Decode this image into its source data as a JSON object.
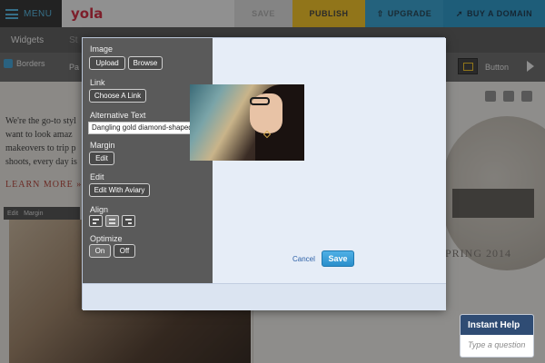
{
  "app": {
    "menu_label": "MENU",
    "logo": "yola",
    "save_label": "SAVE",
    "publish_label": "PUBLISH",
    "upgrade_label": "UPGRADE",
    "buy_domain_label": "BUY A DOMAIN"
  },
  "subbar": {
    "widgets_label": "Widgets",
    "faded_tab_label": "St"
  },
  "toolbar": {
    "borders_label": "Borders",
    "pa_label": "Pa",
    "button_label": "Button"
  },
  "page": {
    "intro_text": "We're the go-to styl want to look amaz makeovers to trip p shoots, every day is",
    "learn_more": "LEARN MORE »",
    "edit_label": "Edit",
    "margin_label": "Margin",
    "spring_text": "PRING 2014"
  },
  "help": {
    "title": "Instant Help",
    "placeholder": "Type a question"
  },
  "modal": {
    "image_heading": "Image",
    "upload_label": "Upload",
    "browse_label": "Browse",
    "link_heading": "Link",
    "choose_link_label": "Choose A Link",
    "alt_heading": "Alternative Text",
    "alt_value": "Dangling gold diamond-shaped e",
    "margin_heading": "Margin",
    "margin_edit_label": "Edit",
    "edit_heading": "Edit",
    "aviary_label": "Edit With Aviary",
    "align_heading": "Align",
    "optimize_heading": "Optimize",
    "on_label": "On",
    "off_label": "Off",
    "cancel_label": "Cancel",
    "save_label": "Save"
  },
  "colors": {
    "accent_blue": "#2e9fd0",
    "publish_yellow": "#f4c21c",
    "logo_red": "#d0243a"
  }
}
